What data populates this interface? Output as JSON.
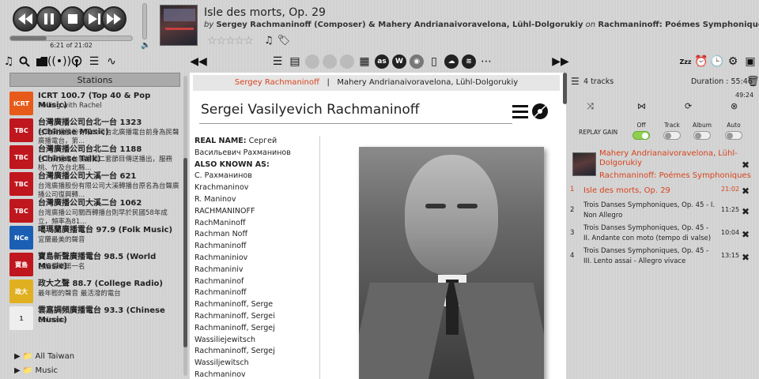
{
  "player": {
    "time": "6:21 of 21:02",
    "progress": 0.3,
    "track_title": "Isle des morts, Op. 29",
    "by_word": "by",
    "artists": "Sergey Rachmaninoff (Composer) & Mahery Andrianaivoravelona, Lühl-Dolgorukiy",
    "on_word": "on",
    "album": "Rachmaninoff: Poémes Symphoniques",
    "stars": "☆☆☆☆☆",
    "rating": 0
  },
  "toolbar": {
    "icons": [
      "music-note-icon",
      "search-icon",
      "folder-icon",
      "radio-tower-icon",
      "podcast-icon",
      "playlist-icon",
      "waveform-icon",
      "collapse-left-icon",
      "list-icon",
      "file-info-icon",
      "prev-icon",
      "next-icon",
      "history-icon",
      "lyrics-icon",
      "lastfm-icon",
      "wikipedia-icon",
      "disc-icon",
      "phone-icon",
      "soundcloud-icon",
      "spotify-icon",
      "dots-icon",
      "expand-right-icon",
      "zzz-icon",
      "alarm-icon",
      "clock-icon",
      "settings-icon",
      "cubes-icon"
    ],
    "lastfm_label": "as",
    "wikipedia_label": "W",
    "zzz_label": "Zzz"
  },
  "stations": {
    "header": "Stations",
    "items": [
      {
        "name": "ICRT 100.7 (Top 40 & Pop Music)",
        "desc": "Rolling with Rachel",
        "logo": "ICRT",
        "logo_color": "#e85a1a"
      },
      {
        "name": "台灣廣播公司台北一台 1323 (Chinese Music)",
        "desc": "台灣廣播股份有限公司台北廣播電台前身為民聲廣播電台，第...",
        "logo": "TBC",
        "logo_color": "#c0161e"
      },
      {
        "name": "台灣廣播公司台北二台 1188 (Chinese Talk)",
        "desc": "台北廣播電台製播第二套節目傳送播出，服務桃、竹及台北縣...",
        "logo": "TBC",
        "logo_color": "#c0161e"
      },
      {
        "name": "台灣廣播公司大溪一台 621",
        "desc": "台灣廣播股份有限公司大溪轉播台原名為台聲廣播公司復興轉...",
        "logo": "TBC",
        "logo_color": "#c0161e"
      },
      {
        "name": "台灣廣播公司大溪二台 1062",
        "desc": "台灣廣播公司關西轉播台則早於民國58年成立，頻率為81...",
        "logo": "TBC",
        "logo_color": "#c0161e"
      },
      {
        "name": "噶瑪蘭廣播電台 97.9 (Folk Music)",
        "desc": "宜蘭最美的聲音",
        "logo": "NCe",
        "logo_color": "#1a5fb4"
      },
      {
        "name": "寶島新聲廣播電台 98.5 (World Music)",
        "desc": "台語音樂第一名",
        "logo": "寶島",
        "logo_color": "#c0161e"
      },
      {
        "name": "政大之聲 88.7 (College Radio)",
        "desc": "最年輕的聲音 最活潑的電台",
        "logo": "政大",
        "logo_color": "#e0b020"
      },
      {
        "name": "雲嘉調頻廣播電台 93.3 (Chinese Music)",
        "desc": "Chinese",
        "logo": "1",
        "logo_color": "#eeeeee"
      }
    ],
    "tree": [
      {
        "label": "All Taiwan"
      },
      {
        "label": "Music"
      }
    ]
  },
  "artist_info": {
    "tab_composer": "Sergey Rachmaninoff",
    "tab_sep": "|",
    "tab_performers": "Mahery Andrianaivoravelona, Lühl-Dolgorukiy",
    "name": "Sergei Vasilyevich Rachmaninoff",
    "real_name_label": "REAL NAME:",
    "real_name": "Сергей Васильевич Рахманинов",
    "aka_label": "ALSO KNOWN AS:",
    "aka": [
      "С. Рахманинов",
      "Krachmaninov",
      "R. Maninov",
      "RACHMANINOFF",
      "RachManinoff",
      "Rachman Noff",
      "Rachmaninoff",
      "Rachmaniniov",
      "Rachmaniniv",
      "Rachmaninof",
      "Rachmaninoff",
      "Rachmaninoff, Serge",
      "Rachmaninoff, Sergei",
      "Rachmaninoff, Sergej",
      "Wassiliejewitsch",
      "Rachmaninoff, Sergej",
      "Wassiljewitsch",
      "Rachmaninov"
    ]
  },
  "playlist": {
    "track_count": "4 tracks",
    "duration": "Duration : 55:46",
    "elapsed": "49:24",
    "replay_gain_label": "REPLAY GAIN",
    "rg_options": [
      "Off",
      "Track",
      "Album",
      "Auto"
    ],
    "rg_selected": "Off",
    "group_artist": "Mahery Andrianaivoravelona, Lühl-Dolgorukiy",
    "group_album": "Rachmaninoff: Poémes Symphoniques",
    "tracks": [
      {
        "num": "1",
        "title": "Isle des morts, Op. 29",
        "dur": "21:02",
        "current": true
      },
      {
        "num": "2",
        "title": "Trois Danses Symphoniques, Op. 45 - I. Non Allegro",
        "dur": "11:25"
      },
      {
        "num": "3",
        "title": "Trois Danses Symphoniques, Op. 45 - II. Andante con moto (tempo di valse)",
        "dur": "10:04"
      },
      {
        "num": "4",
        "title": "Trois Danses Symphoniques, Op. 45 - III. Lento assai - Allegro vivace",
        "dur": "13:15"
      }
    ],
    "remove_glyph": "✖"
  },
  "colors": {
    "accent": "#d8431d",
    "toggle_on": "#8fd14f"
  }
}
